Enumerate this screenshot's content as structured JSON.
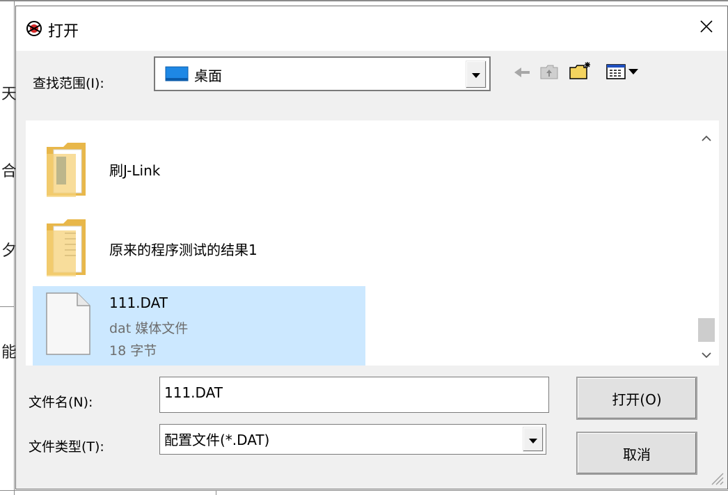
{
  "dialog": {
    "title": "打开",
    "close_glyph": "✕",
    "icon": "app-icon"
  },
  "look_in": {
    "label": "查找范围(I):",
    "value": "桌面",
    "icon": "desktop-folder-icon"
  },
  "toolbar": {
    "icons": [
      "back-arrow-icon",
      "up-folder-icon",
      "new-folder-icon",
      "view-menu-icon"
    ]
  },
  "files": [
    {
      "name": "刷J-Link",
      "type": "folder",
      "icon": "folder-icon"
    },
    {
      "name": "原来的程序测试的结果1",
      "type": "folder",
      "icon": "folder-icon"
    },
    {
      "name": "111.DAT",
      "type": "file",
      "subtitle": "dat 媒体文件",
      "size": "18 字节",
      "icon": "file-icon",
      "selected": true
    }
  ],
  "filename": {
    "label": "文件名(N):",
    "value": "111.DAT"
  },
  "filetype": {
    "label": "文件类型(T):",
    "value": "配置文件(*.DAT)"
  },
  "buttons": {
    "open": "打开(O)",
    "cancel": "取消"
  },
  "background": {
    "chars": [
      "天",
      "合",
      "夕",
      "能"
    ]
  },
  "colors": {
    "selection": "#cce8ff",
    "dialog_bg": "#f0f0f0",
    "desktop_blue": "#1e88e5"
  }
}
